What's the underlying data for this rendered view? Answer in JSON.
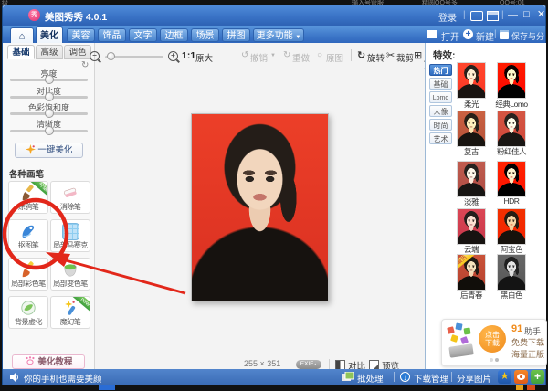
{
  "desktop": {
    "top_text": [
      "级",
      "输入号管服",
      "精圆QQ号多",
      "QQ号:01"
    ]
  },
  "titlebar": {
    "logo_char": "秀",
    "title": "美图秀秀 4.0.1",
    "login": "登录"
  },
  "icons": {
    "home": "⌂",
    "chevron_down": "▼",
    "chevron_up": "▲",
    "minimize": "—",
    "maximize": "□",
    "close": "✕",
    "separator": "|",
    "reset": "↻",
    "minus": "−",
    "plus": "+",
    "undo": "↺",
    "redo": "↻",
    "original": "○",
    "rotate": "↻",
    "crop": "✂",
    "resize": "⊞",
    "star": "★",
    "download_arrow": "↓"
  },
  "tabbar": {
    "tabs": [
      {
        "label": "美化",
        "active": true
      },
      {
        "label": "美容"
      },
      {
        "label": "饰品"
      },
      {
        "label": "文字"
      },
      {
        "label": "边框"
      },
      {
        "label": "场景"
      },
      {
        "label": "拼图"
      },
      {
        "label": "更多功能"
      }
    ],
    "actions": {
      "open": "打开",
      "new": "新建",
      "save_share": "保存与分享"
    }
  },
  "left_panel": {
    "tabs": [
      {
        "label": "基础",
        "active": true
      },
      {
        "label": "高级"
      },
      {
        "label": "调色"
      }
    ],
    "sliders": [
      {
        "label": "亮度",
        "value": 50
      },
      {
        "label": "对比度",
        "value": 50
      },
      {
        "label": "色彩饱和度",
        "value": 50
      },
      {
        "label": "清晰度",
        "value": 50
      }
    ],
    "one_key_button": "一键美化",
    "brushes_header": "各种画笔",
    "tools": [
      {
        "label": "涂鸦笔",
        "badge": "升级"
      },
      {
        "label": "消除笔"
      },
      {
        "label": "抠图笔"
      },
      {
        "label": "局部马赛克"
      },
      {
        "label": "局部彩色笔"
      },
      {
        "label": "局部变色笔"
      },
      {
        "label": "背景虚化"
      },
      {
        "label": "魔幻笔",
        "badge": "new"
      }
    ],
    "tutorial_button": "美化教程"
  },
  "toolbar": {
    "zoom_ratio": "1:1",
    "zoom_label": "原大",
    "undo": "撤销",
    "redo": "重做",
    "original": "原图",
    "rotate": "旋转",
    "crop": "裁剪",
    "resize": "尺寸"
  },
  "canvas": {
    "image_size": "255 × 351",
    "exif": "EXIF",
    "compare": "对比",
    "preview": "预览"
  },
  "effects_panel": {
    "header": "特效:",
    "tabs": [
      {
        "label": "热门",
        "active": true
      },
      {
        "label": "基础"
      },
      {
        "label": "Lomo"
      },
      {
        "label": "人像"
      },
      {
        "label": "时尚"
      },
      {
        "label": "艺术"
      }
    ],
    "items": [
      {
        "label": "柔光"
      },
      {
        "label": "经典Lomo"
      },
      {
        "label": "复古"
      },
      {
        "label": "粉红佳人"
      },
      {
        "label": "淡雅"
      },
      {
        "label": "HDR"
      },
      {
        "label": "云端"
      },
      {
        "label": "阿宝色"
      },
      {
        "label": "后青春",
        "badge": "最热"
      },
      {
        "label": "黑白色"
      }
    ]
  },
  "ad": {
    "download_button": "点击下载",
    "brand_num": "91",
    "brand_txt": "助手",
    "line1": "免费下载",
    "line2": "海量正版"
  },
  "bottom_bar": {
    "notice": "你的手机也需要美颜",
    "batch": "批处理",
    "download_manager": "下载管理",
    "share": "分享图片"
  },
  "colors": {
    "titlebar_blue": "#3a73c6",
    "accent_red": "#e2271a",
    "photo_bg_red": "#e43726",
    "ribbon_green": "#4caf50",
    "ad_orange": "#f08c1e"
  }
}
